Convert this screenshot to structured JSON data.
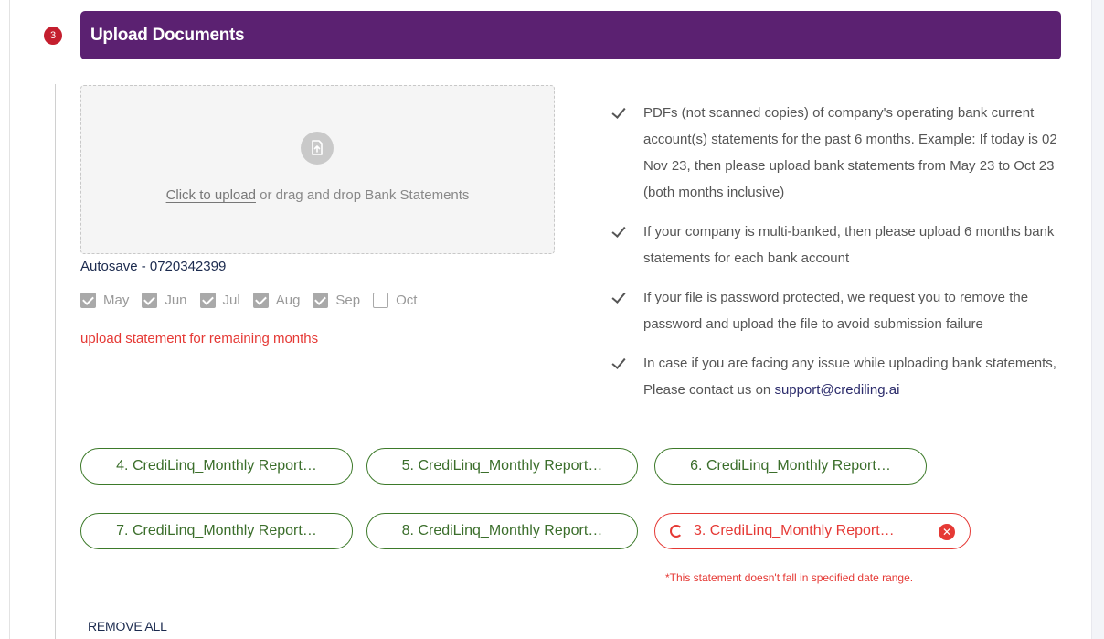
{
  "step": {
    "number": "3",
    "title": "Upload Documents"
  },
  "dropzone": {
    "icon": "upload-file-icon",
    "link_text": "Click to upload",
    "rest_text": " or drag and drop Bank Statements"
  },
  "autosave": "Autosave - 0720342399",
  "months": [
    {
      "label": "May",
      "checked": true
    },
    {
      "label": "Jun",
      "checked": true
    },
    {
      "label": "Jul",
      "checked": true
    },
    {
      "label": "Aug",
      "checked": true
    },
    {
      "label": "Sep",
      "checked": true
    },
    {
      "label": "Oct",
      "checked": false
    }
  ],
  "remaining_warning": "upload statement for remaining months",
  "guidelines": [
    {
      "text": "PDFs (not scanned copies) of company's operating bank current account(s) statements for the past 6 months. Example: If today is 02 Nov 23, then please upload bank statements from May 23 to Oct 23 (both months inclusive)"
    },
    {
      "text": "If your company is multi-banked, then please upload 6 months bank statements for each bank account"
    },
    {
      "text": "If your file is password protected, we request you to remove the password and upload the file to avoid submission failure"
    },
    {
      "text_before": "In case if you are facing any issue while uploading bank statements, Please contact us on ",
      "email": "support@crediling.ai"
    }
  ],
  "files": [
    {
      "label": "4. CrediLinq_Monthly Report…",
      "status": "ok"
    },
    {
      "label": "5. CrediLinq_Monthly Report…",
      "status": "ok"
    },
    {
      "label": "6. CrediLinq_Monthly Report…",
      "status": "ok"
    },
    {
      "label": "7. CrediLinq_Monthly Report…",
      "status": "ok"
    },
    {
      "label": "8. CrediLinq_Monthly Report…",
      "status": "ok"
    },
    {
      "label": "3. CrediLinq_Monthly Report…",
      "status": "error"
    }
  ],
  "file_error": "*This statement doesn't fall in specified date range.",
  "remove_all": "REMOVE ALL",
  "colors": {
    "header": "#5b2171",
    "badge": "#c41e2e",
    "success": "#3d7a2a",
    "error": "#e53935"
  }
}
